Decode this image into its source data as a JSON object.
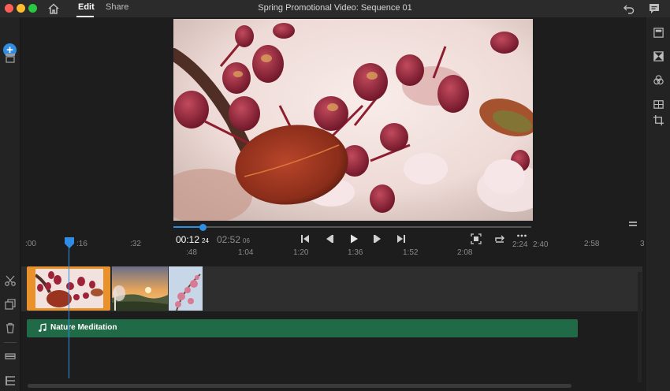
{
  "titlebar": {
    "traffic_lights": [
      {
        "name": "close",
        "color": "#ff5f57"
      },
      {
        "name": "minimize",
        "color": "#febc2e"
      },
      {
        "name": "zoom",
        "color": "#28c840"
      }
    ],
    "home_icon": "home-icon",
    "tabs": [
      {
        "label": "Edit",
        "active": true
      },
      {
        "label": "Share",
        "active": false
      }
    ],
    "title": "Spring Promotional Video: Sequence 01",
    "undo_icon": "undo-icon",
    "chat_icon": "chat-icon"
  },
  "left_toolbar": {
    "items": [
      "add-media-icon",
      "archive-icon",
      "scissors-icon",
      "duplicate-icon",
      "trash-icon",
      "track-height-icon",
      "list-icon"
    ]
  },
  "right_toolbar": {
    "items": [
      "title-icon",
      "transition-icon",
      "color-icon",
      "layout-icon",
      "crop-icon"
    ]
  },
  "playback": {
    "current_time": "00:12",
    "current_frames": "24",
    "total_time": "02:52",
    "total_frames": "06",
    "progress": 0.07,
    "controls": [
      "skip-to-start-icon",
      "step-back-icon",
      "play-icon",
      "step-forward-icon",
      "skip-to-end-icon"
    ],
    "tools": [
      "fullscreen-icon",
      "loop-icon",
      "more-icon"
    ]
  },
  "ruler": {
    "upper": [
      ":00",
      ":16",
      ":32",
      "2:24",
      "2:40",
      "2:58",
      "3"
    ],
    "lower": [
      ":48",
      "1:04",
      "1:20",
      "1:36",
      "1:52",
      "2:08"
    ]
  },
  "timeline": {
    "clips": [
      "flower-clip",
      "sunset-clip",
      "blossom-clip"
    ],
    "audio_track_name": "Nature Meditation",
    "accent": "#2f8de4",
    "selected_clip_color": "#e9922b",
    "audio_color": "#216a47"
  }
}
